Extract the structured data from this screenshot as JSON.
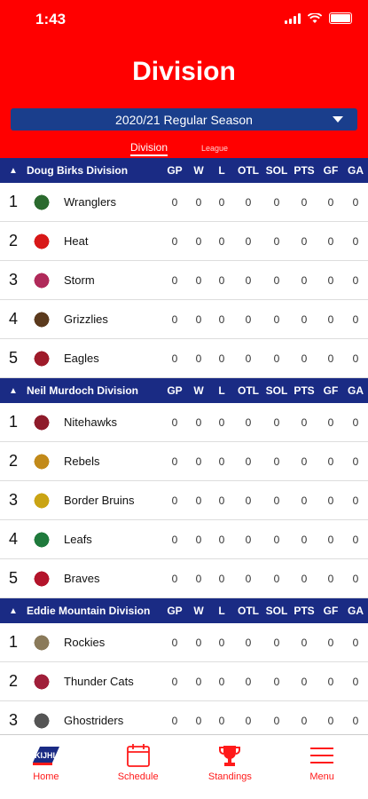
{
  "status": {
    "time": "1:43"
  },
  "header": {
    "title": "Division",
    "season": "2020/21 Regular Season",
    "tabs": {
      "division": "Division",
      "league": "League"
    }
  },
  "columns": [
    "GP",
    "W",
    "L",
    "OTL",
    "SOL",
    "PTS",
    "GF",
    "GA"
  ],
  "divisions": [
    {
      "name": "Doug Birks Division",
      "teams": [
        {
          "rank": "1",
          "name": "Wranglers",
          "logo_color": "#2b6a2e",
          "stats": [
            "0",
            "0",
            "0",
            "0",
            "0",
            "0",
            "0",
            "0"
          ]
        },
        {
          "rank": "2",
          "name": "Heat",
          "logo_color": "#d81818",
          "stats": [
            "0",
            "0",
            "0",
            "0",
            "0",
            "0",
            "0",
            "0"
          ]
        },
        {
          "rank": "3",
          "name": "Storm",
          "logo_color": "#b02a5a",
          "stats": [
            "0",
            "0",
            "0",
            "0",
            "0",
            "0",
            "0",
            "0"
          ]
        },
        {
          "rank": "4",
          "name": "Grizzlies",
          "logo_color": "#5b3a1d",
          "stats": [
            "0",
            "0",
            "0",
            "0",
            "0",
            "0",
            "0",
            "0"
          ]
        },
        {
          "rank": "5",
          "name": "Eagles",
          "logo_color": "#9e1b2a",
          "stats": [
            "0",
            "0",
            "0",
            "0",
            "0",
            "0",
            "0",
            "0"
          ]
        }
      ]
    },
    {
      "name": "Neil Murdoch Division",
      "teams": [
        {
          "rank": "1",
          "name": "Nitehawks",
          "logo_color": "#8e1b2a",
          "stats": [
            "0",
            "0",
            "0",
            "0",
            "0",
            "0",
            "0",
            "0"
          ]
        },
        {
          "rank": "2",
          "name": "Rebels",
          "logo_color": "#c28a1a",
          "stats": [
            "0",
            "0",
            "0",
            "0",
            "0",
            "0",
            "0",
            "0"
          ]
        },
        {
          "rank": "3",
          "name": "Border Bruins",
          "logo_color": "#caa414",
          "stats": [
            "0",
            "0",
            "0",
            "0",
            "0",
            "0",
            "0",
            "0"
          ]
        },
        {
          "rank": "4",
          "name": "Leafs",
          "logo_color": "#1f7a3c",
          "stats": [
            "0",
            "0",
            "0",
            "0",
            "0",
            "0",
            "0",
            "0"
          ]
        },
        {
          "rank": "5",
          "name": "Braves",
          "logo_color": "#b3142b",
          "stats": [
            "0",
            "0",
            "0",
            "0",
            "0",
            "0",
            "0",
            "0"
          ]
        }
      ]
    },
    {
      "name": "Eddie Mountain Division",
      "teams": [
        {
          "rank": "1",
          "name": "Rockies",
          "logo_color": "#8a7a5a",
          "stats": [
            "0",
            "0",
            "0",
            "0",
            "0",
            "0",
            "0",
            "0"
          ]
        },
        {
          "rank": "2",
          "name": "Thunder Cats",
          "logo_color": "#a01f3a",
          "stats": [
            "0",
            "0",
            "0",
            "0",
            "0",
            "0",
            "0",
            "0"
          ]
        },
        {
          "rank": "3",
          "name": "Ghostriders",
          "logo_color": "#555555",
          "stats": [
            "0",
            "0",
            "0",
            "0",
            "0",
            "0",
            "0",
            "0"
          ]
        }
      ]
    }
  ],
  "tabbar": [
    {
      "label": "Home",
      "icon": "league-logo-icon"
    },
    {
      "label": "Schedule",
      "icon": "calendar-icon"
    },
    {
      "label": "Standings",
      "icon": "trophy-icon"
    },
    {
      "label": "Menu",
      "icon": "hamburger-menu-icon"
    }
  ],
  "colors": {
    "primary_red": "#ff0000",
    "navy": "#1a2b84",
    "select_blue": "#1a3e8c"
  }
}
